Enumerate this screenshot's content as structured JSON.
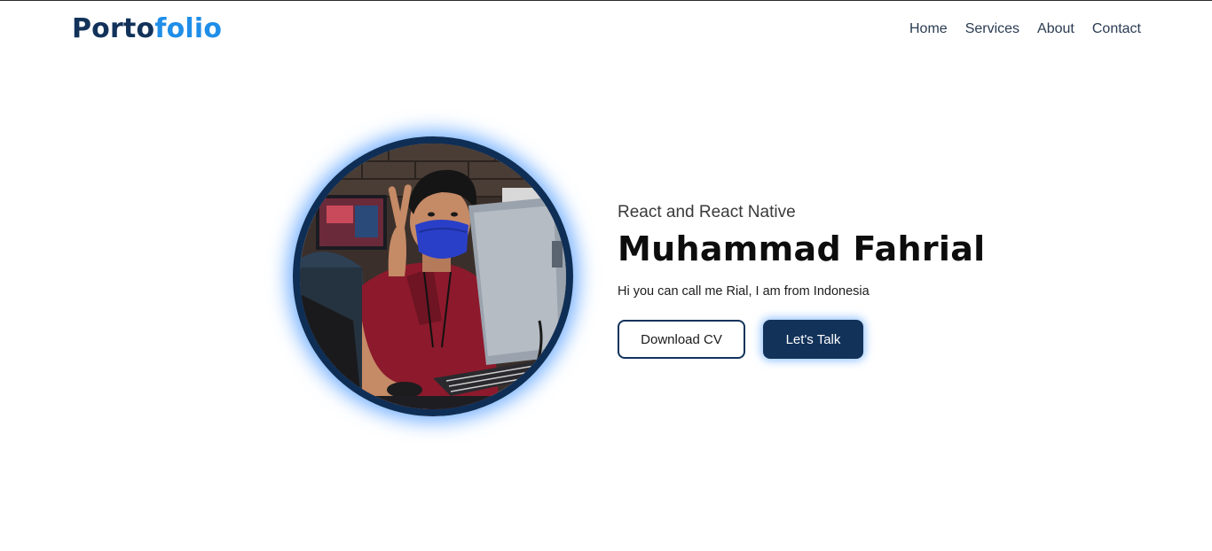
{
  "brand": {
    "part1": "Porto",
    "part2": "folio"
  },
  "nav": {
    "items": [
      {
        "label": "Home"
      },
      {
        "label": "Services"
      },
      {
        "label": "About"
      },
      {
        "label": "Contact"
      }
    ]
  },
  "hero": {
    "subtitle": "React and React Native",
    "name": "Muhammad Fahrial",
    "intro": "Hi you can call me Rial, I am from Indonesia",
    "download_label": "Download CV",
    "talk_label": "Let's Talk"
  },
  "colors": {
    "brand_dark": "#12325a",
    "brand_light": "#1f8ee8",
    "glow": "#4696ff"
  }
}
